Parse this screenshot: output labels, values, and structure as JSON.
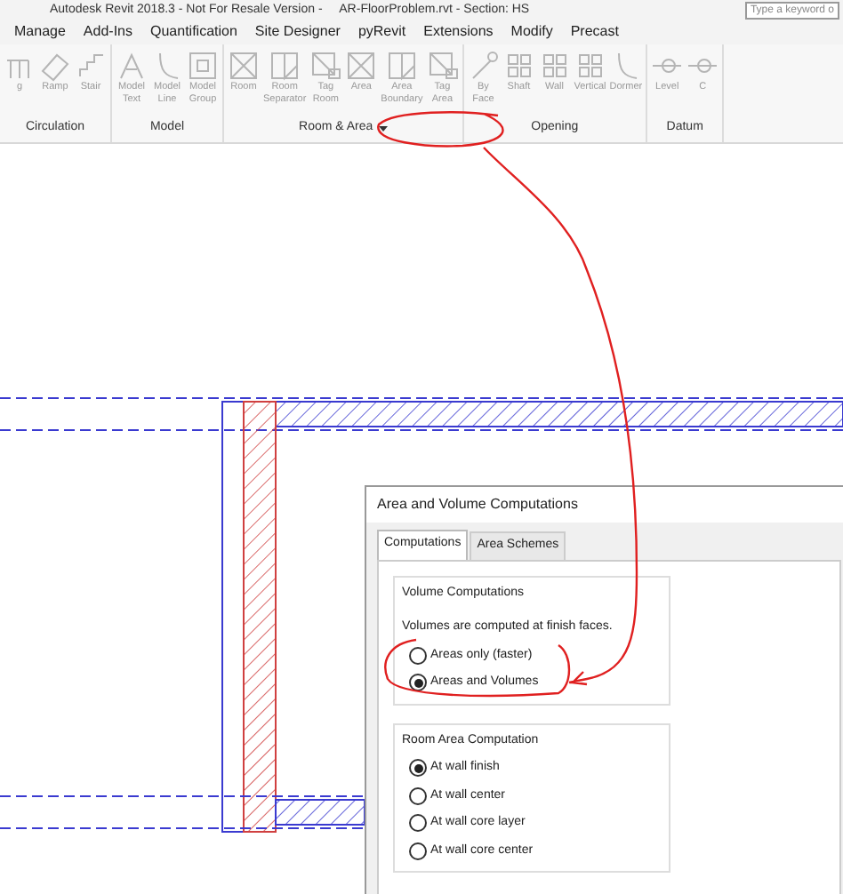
{
  "window": {
    "title": "Autodesk Revit 2018.3 - Not For Resale Version -     AR-FloorProblem.rvt - Section: HS",
    "search": {
      "placeholder": "Type a keyword o"
    }
  },
  "menu_tabs": [
    "Manage",
    "Add-Ins",
    "Quantification",
    "Site Designer",
    "pyRevit",
    "Extensions",
    "Modify",
    "Precast"
  ],
  "ribbon_panels": [
    {
      "title": "Circulation",
      "tools": [
        {
          "label": [
            "g"
          ],
          "kind": "railing"
        },
        {
          "label": [
            "Ramp"
          ],
          "kind": "ramp"
        },
        {
          "label": [
            "Stair"
          ],
          "kind": "stair"
        }
      ]
    },
    {
      "title": "Model",
      "tools": [
        {
          "label": [
            "Model",
            "Text"
          ],
          "kind": "text"
        },
        {
          "label": [
            "Model",
            "Line"
          ],
          "kind": "line"
        },
        {
          "label": [
            "Model",
            "Group"
          ],
          "kind": "group"
        }
      ]
    },
    {
      "title": "Room & Area",
      "dropdown": true,
      "tools": [
        {
          "label": [
            "Room"
          ],
          "kind": "room"
        },
        {
          "label": [
            "Room",
            "Separator"
          ],
          "kind": "separator"
        },
        {
          "label": [
            "Tag",
            "Room"
          ],
          "kind": "tag"
        },
        {
          "label": [
            "Area"
          ],
          "kind": "room"
        },
        {
          "label": [
            "Area",
            "Boundary"
          ],
          "kind": "separator"
        },
        {
          "label": [
            "Tag",
            "Area"
          ],
          "kind": "tag"
        }
      ]
    },
    {
      "title": "Opening",
      "tools": [
        {
          "label": [
            "By",
            "Face"
          ],
          "kind": "face"
        },
        {
          "label": [
            "Shaft"
          ],
          "kind": "shaft"
        },
        {
          "label": [
            "Wall"
          ],
          "kind": "shaft"
        },
        {
          "label": [
            "Vertical"
          ],
          "kind": "shaft"
        },
        {
          "label": [
            "Dormer"
          ],
          "kind": "line"
        }
      ]
    },
    {
      "title": "Datum",
      "tools": [
        {
          "label": [
            "Level"
          ],
          "kind": "level"
        },
        {
          "label": [
            "C"
          ],
          "kind": "level"
        }
      ]
    }
  ],
  "dialog": {
    "title": "Area and Volume Computations",
    "tabs": [
      {
        "label": "Computations",
        "selected": true
      },
      {
        "label": "Area Schemes",
        "selected": false
      }
    ],
    "groups": [
      {
        "title": "Volume Computations",
        "note": "Volumes are computed at finish faces.",
        "options": [
          {
            "label": "Areas only (faster)",
            "selected": false
          },
          {
            "label": "Areas and Volumes",
            "selected": true
          }
        ]
      },
      {
        "title": "Room Area Computation",
        "options": [
          {
            "label": "At wall finish",
            "selected": true
          },
          {
            "label": "At wall center",
            "selected": false
          },
          {
            "label": "At wall core layer",
            "selected": false
          },
          {
            "label": "At wall core center",
            "selected": false
          }
        ]
      }
    ]
  }
}
